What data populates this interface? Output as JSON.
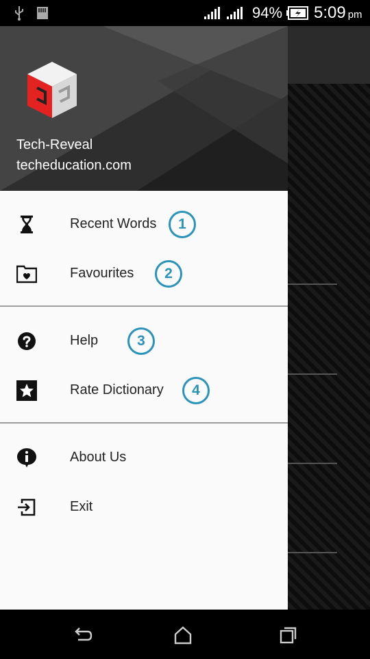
{
  "status_bar": {
    "battery_percent": "94%",
    "time": "5:09",
    "ampm": "pm",
    "icons": [
      "usb-icon",
      "sd-card-icon",
      "signal-icon",
      "signal-icon",
      "battery-charging-icon"
    ]
  },
  "drawer": {
    "header": {
      "title": "Tech-Reveal",
      "subtitle": "techeducation.com"
    },
    "items": [
      {
        "label": "Recent Words",
        "icon": "hourglass-icon",
        "badge": "1"
      },
      {
        "label": "Favourites",
        "icon": "folder-heart-icon",
        "badge": "2"
      },
      {
        "label": "Help",
        "icon": "help-circle-icon",
        "badge": "3"
      },
      {
        "label": "Rate Dictionary",
        "icon": "star-box-icon",
        "badge": "4"
      },
      {
        "label": "About Us",
        "icon": "info-bubble-icon"
      },
      {
        "label": "Exit",
        "icon": "exit-icon"
      }
    ]
  },
  "colors": {
    "badge": "#2a93bb",
    "logo_red": "#e52222",
    "header_bg": "#3a3a3a"
  },
  "nav_bar": {
    "buttons": [
      "back-icon",
      "home-icon",
      "recents-icon"
    ]
  }
}
